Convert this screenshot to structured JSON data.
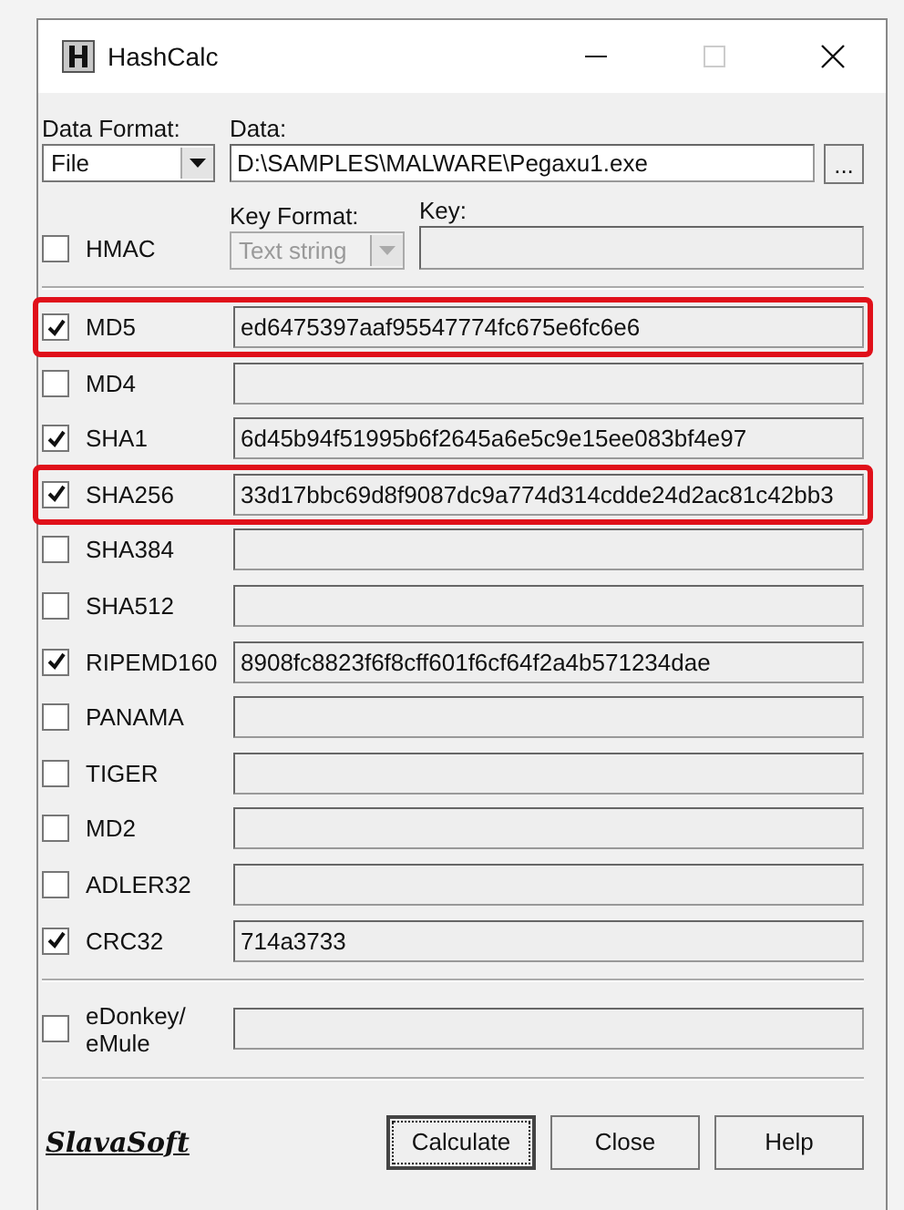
{
  "window": {
    "title": "HashCalc"
  },
  "data_format": {
    "label": "Data Format:",
    "value": "File"
  },
  "data": {
    "label": "Data:",
    "value": "D:\\SAMPLES\\MALWARE\\Pegaxu1.exe",
    "browse": "..."
  },
  "hmac": {
    "label": "HMAC",
    "checked": false
  },
  "key_format": {
    "label": "Key Format:",
    "value": "Text string",
    "disabled": true
  },
  "key": {
    "label": "Key:",
    "disabled": true
  },
  "hashes": [
    {
      "name": "MD5",
      "checked": true,
      "value": "ed6475397aaf95547774fc675e6fc6e6",
      "highlighted": true
    },
    {
      "name": "MD4",
      "checked": false,
      "highlighted": false
    },
    {
      "name": "SHA1",
      "checked": true,
      "value": "6d45b94f51995b6f2645a6e5c9e15ee083bf4e97",
      "highlighted": false
    },
    {
      "name": "SHA256",
      "checked": true,
      "value": "33d17bbc69d8f9087dc9a774d314cdde24d2ac81c42bb3",
      "highlighted": true
    },
    {
      "name": "SHA384",
      "checked": false,
      "highlighted": false
    },
    {
      "name": "SHA512",
      "checked": false,
      "highlighted": false
    },
    {
      "name": "RIPEMD160",
      "checked": true,
      "value": "8908fc8823f6f8cff601f6cf64f2a4b571234dae",
      "highlighted": false
    },
    {
      "name": "PANAMA",
      "checked": false,
      "highlighted": false
    },
    {
      "name": "TIGER",
      "checked": false,
      "highlighted": false
    },
    {
      "name": "MD2",
      "checked": false,
      "highlighted": false
    },
    {
      "name": "ADLER32",
      "checked": false,
      "highlighted": false
    },
    {
      "name": "CRC32",
      "checked": true,
      "value": "714a3733",
      "highlighted": false
    }
  ],
  "edonkey": {
    "name": "eDonkey/ eMule",
    "checked": false
  },
  "logo": "SlavaSoft",
  "buttons": [
    {
      "label": "Calculate",
      "focused": true
    },
    {
      "label": "Close",
      "focused": false
    },
    {
      "label": "Help",
      "focused": false
    }
  ]
}
